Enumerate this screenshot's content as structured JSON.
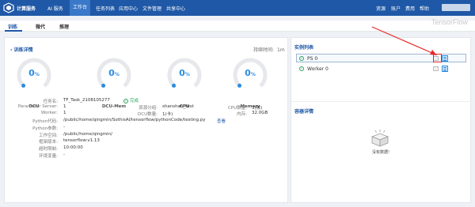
{
  "nav": {
    "brand": "计算服务",
    "items": [
      {
        "label": "AI 服务",
        "active": false
      },
      {
        "label": "工作台",
        "active": true
      },
      {
        "label": "任务列表",
        "active": false
      },
      {
        "label": "应用中心",
        "active": false
      },
      {
        "label": "文件管理",
        "active": false
      },
      {
        "label": "共享中心",
        "active": false
      }
    ],
    "right": [
      "资源",
      "账户",
      "费用",
      "帮助"
    ]
  },
  "subtabs": [
    {
      "label": "训练",
      "active": true
    },
    {
      "label": "微代",
      "active": false
    },
    {
      "label": "推理",
      "active": false
    }
  ],
  "watermark": "TensorFlow",
  "training": {
    "title": "训练详情",
    "duration_label": "持续时间:",
    "duration_value": "1m",
    "gauges": [
      {
        "label": "DCU",
        "value": "0",
        "unit": "%",
        "percent": 0
      },
      {
        "label": "DCU-Mem",
        "value": "0",
        "unit": "%",
        "percent": 0
      },
      {
        "label": "CPU",
        "value": "0",
        "unit": "%",
        "percent": 0
      },
      {
        "label": "Memory",
        "value": "0",
        "unit": "%",
        "percent": 0
      }
    ],
    "info": {
      "task_name_label": "任务名:",
      "task_name": "TF_Task_2108105277",
      "status": "完成",
      "ps_label": "Parameter Server:",
      "ps_value": "1",
      "resource_group_label": "资源分组:",
      "resource_group": "shanshan_test",
      "cpu_count_label": "CPU数量:",
      "cpu_count": "3(核)",
      "worker_label": "Worker:",
      "worker_value": "1",
      "dcu_count_label": "DCU数量:",
      "dcu_count": "1(卡)",
      "memory_label": "内存:",
      "memory_value": "32.0GB",
      "python_code_label": "Python代码:",
      "python_code": "/public/home/qingmin/SothisAI/tensorflow/pythonCode/testing.py",
      "view_link": "查看",
      "python_params_label": "Python参数:",
      "python_params": "-",
      "workdir_label": "工作空间:",
      "workdir": "/public/home/qingmin/",
      "framework_label": "框架版本:",
      "framework": "tensorflow:v1.13",
      "runtime_label": "超时限制:",
      "runtime": "10:00:00",
      "env_label": "环境变量:",
      "env": "-"
    }
  },
  "instances": {
    "title": "实例列表",
    "rows": [
      {
        "name": "PS 0",
        "selected": true
      },
      {
        "name": "Worker 0",
        "selected": false
      }
    ]
  },
  "container": {
    "title": "容器详情",
    "empty_text": "没有数据!"
  },
  "colors": {
    "nav_bg": "#1f58a6",
    "accent": "#1f58a6",
    "gauge": "#2a8be0",
    "ok": "#2aa55f",
    "highlight": "#e5292a"
  }
}
